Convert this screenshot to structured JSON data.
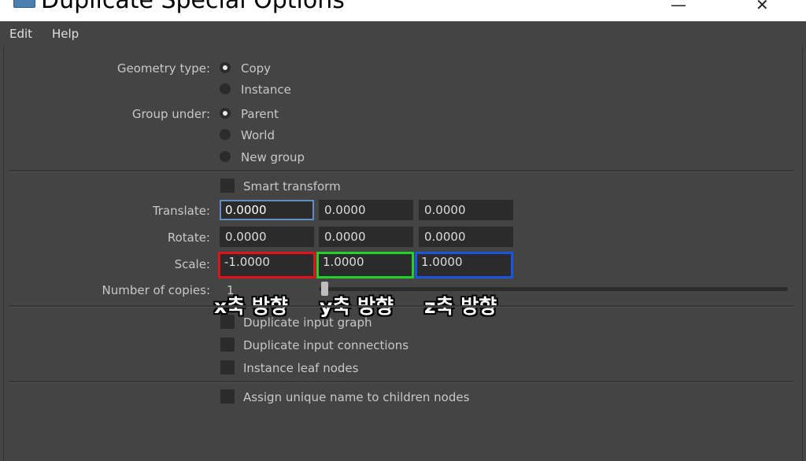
{
  "window": {
    "title": "Duplicate Special Options",
    "minimize_glyph": "—",
    "close_glyph": "✕",
    "icon": "maya-app-icon"
  },
  "menu": {
    "edit": "Edit",
    "help": "Help"
  },
  "geometry": {
    "label": "Geometry type:",
    "options": [
      "Copy",
      "Instance"
    ],
    "selected": "Copy"
  },
  "group": {
    "label": "Group under:",
    "options": [
      "Parent",
      "World",
      "New group"
    ],
    "selected": "Parent"
  },
  "smart_transform": {
    "label": "Smart transform",
    "checked": false
  },
  "translate": {
    "label": "Translate:",
    "values": [
      "0.0000",
      "0.0000",
      "0.0000"
    ]
  },
  "rotate": {
    "label": "Rotate:",
    "values": [
      "0.0000",
      "0.0000",
      "0.0000"
    ]
  },
  "scale": {
    "label": "Scale:",
    "values": [
      "-1.0000",
      "1.0000",
      "1.0000"
    ]
  },
  "copies": {
    "label": "Number of copies:",
    "value": "1",
    "slider_fraction": 0.0
  },
  "annotations": {
    "x": "x축 방향",
    "y": "y축 방향",
    "z": "z축 방향",
    "colors": {
      "x": "#e3121a",
      "y": "#23d12a",
      "z": "#1a55e0"
    }
  },
  "options": {
    "duplicate_input_graph": "Duplicate input graph",
    "duplicate_input_connections": "Duplicate input connections",
    "instance_leaf_nodes": "Instance leaf nodes",
    "assign_unique_name": "Assign unique name to children nodes"
  }
}
